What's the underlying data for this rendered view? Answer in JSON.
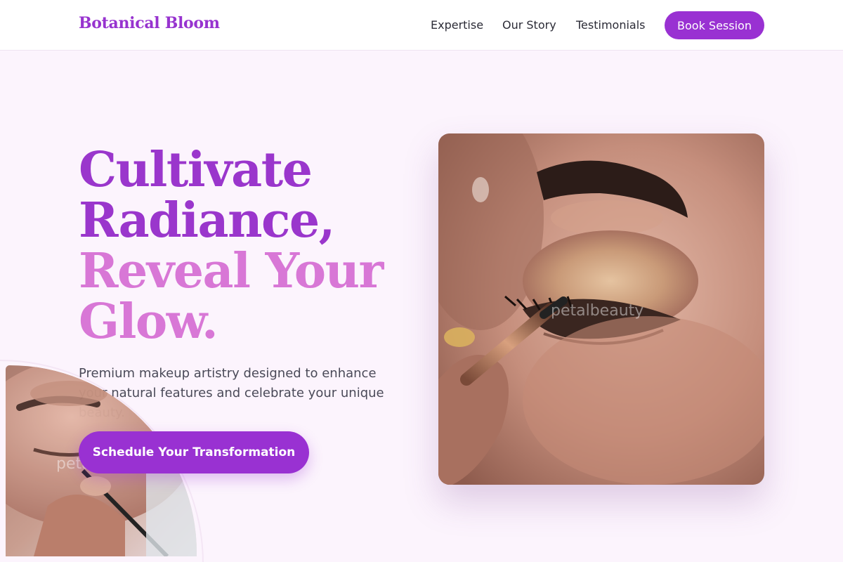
{
  "header": {
    "logo": "Botanical Bloom",
    "nav": [
      {
        "label": "Expertise"
      },
      {
        "label": "Our Story"
      },
      {
        "label": "Testimonials"
      }
    ],
    "book_button": "Book Session"
  },
  "hero": {
    "headline_line1": "Cultivate",
    "headline_line2": "Radiance,",
    "headline_line3": "Reveal Your",
    "headline_line4": "Glow.",
    "subtitle": "Premium makeup artistry designed to enhance your natural features and celebrate your unique beauty.",
    "cta": "Schedule Your Transformation",
    "hero_watermark": "petalbeauty",
    "corner_watermark": "petal"
  },
  "colors": {
    "brand": "#9931d2",
    "headline_dark": "#9a36cc",
    "headline_light": "#d877d6",
    "background": "#fcf4fd"
  }
}
